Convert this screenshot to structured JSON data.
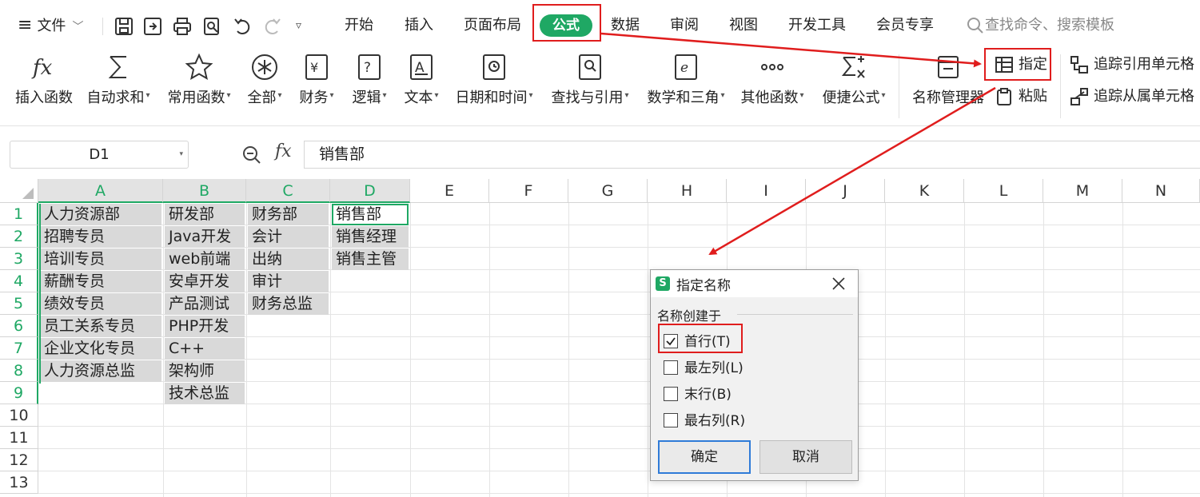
{
  "menu": {
    "hamburger": "≡",
    "file": "文件",
    "tabs": [
      "开始",
      "插入",
      "页面布局",
      "公式",
      "数据",
      "审阅",
      "视图",
      "开发工具",
      "会员专享"
    ],
    "active_tab": "公式",
    "search_placeholder": "查找命令、搜索模板"
  },
  "tools": {
    "insert_func": "插入函数",
    "autosum": "自动求和",
    "common": "常用函数",
    "all": "全部",
    "finance": "财务",
    "logic": "逻辑",
    "text": "文本",
    "datetime": "日期和时间",
    "lookup": "查找与引用",
    "math": "数学和三角",
    "other": "其他函数",
    "shortcut": "便捷公式",
    "name_manager": "名称管理器",
    "designate": "指定",
    "paste": "粘贴",
    "trace_precedents": "追踪引用单元格",
    "trace_dependents": "追踪从属单元格"
  },
  "formula_bar": {
    "name_box": "D1",
    "fx": "fx",
    "content": "销售部"
  },
  "sheet": {
    "columns": [
      "A",
      "B",
      "C",
      "D",
      "E",
      "F",
      "G",
      "H",
      "I",
      "J",
      "K",
      "L",
      "M",
      "N"
    ],
    "rows": [
      "1",
      "2",
      "3",
      "4",
      "5",
      "6",
      "7",
      "8",
      "9",
      "10",
      "11",
      "12",
      "13"
    ],
    "col_A": [
      "人力资源部",
      "招聘专员",
      "培训专员",
      "薪酬专员",
      "绩效专员",
      "员工关系专员",
      "企业文化专员",
      "人力资源总监"
    ],
    "col_B": [
      "研发部",
      "Java开发",
      "web前端",
      "安卓开发",
      "产品测试",
      "PHP开发",
      "C++",
      "架构师",
      "技术总监"
    ],
    "col_C": [
      "财务部",
      "会计",
      "出纳",
      "审计",
      "财务总监"
    ],
    "col_D": [
      "销售部",
      "销售经理",
      "销售主管"
    ]
  },
  "dialog": {
    "logo": "S",
    "title": "指定名称",
    "group": "名称创建于",
    "options": [
      {
        "label": "首行(T)",
        "checked": true
      },
      {
        "label": "最左列(L)",
        "checked": false
      },
      {
        "label": "末行(B)",
        "checked": false
      },
      {
        "label": "最右列(R)",
        "checked": false
      }
    ],
    "ok": "确定",
    "cancel": "取消"
  },
  "colors": {
    "accent_green": "#1fa864",
    "annotation_red": "#e01d1d",
    "selection_fill": "#d9d9d9"
  }
}
